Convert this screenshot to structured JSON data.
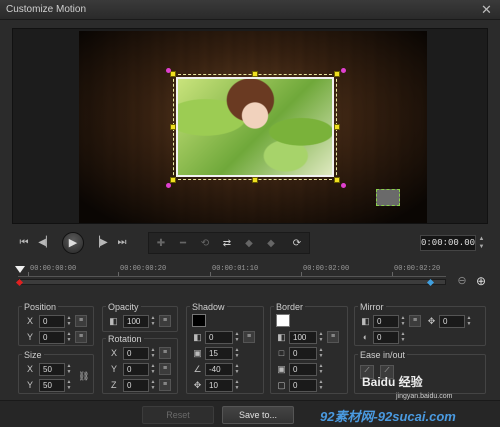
{
  "window": {
    "title": "Customize Motion",
    "close_glyph": "✕"
  },
  "player": {
    "timecode": "0:00:00.00",
    "buttons": [
      "go-to-start",
      "previous-frame",
      "play",
      "next-frame",
      "go-to-end"
    ]
  },
  "keyframe_tools": [
    "add-keyframe",
    "remove-keyframe",
    "reverse-keyframe",
    "swap-keyframes",
    "previous-keyframe",
    "next-keyframe",
    "duplicate-keyframe"
  ],
  "timeline": {
    "labels": [
      "00:00:00:00",
      "00:00:00:20",
      "00:00:01:10",
      "00:00:02:00",
      "00:00:02:20"
    ],
    "playhead_fraction": 0.0
  },
  "position": {
    "title": "Position",
    "x_label": "X",
    "x": "0",
    "y_label": "Y",
    "y": "0"
  },
  "size": {
    "title": "Size",
    "x_label": "X",
    "x": "50",
    "y_label": "Y",
    "y": "50"
  },
  "opacity": {
    "title": "Opacity",
    "value": "100"
  },
  "rotation": {
    "title": "Rotation",
    "x_label": "X",
    "x": "0",
    "y_label": "Y",
    "y": "0",
    "z_label": "Z",
    "z": "0"
  },
  "shadow": {
    "title": "Shadow",
    "color": "#000000",
    "opacity": "0",
    "blur": "15",
    "direction": "-40",
    "distance": "10"
  },
  "border": {
    "title": "Border",
    "color": "#ffffff",
    "opacity": "100",
    "width": "0",
    "blur": "0",
    "distance": "0"
  },
  "mirror": {
    "title": "Mirror",
    "opacity": "0",
    "distance": "0",
    "offset": "0"
  },
  "ease": {
    "title": "Ease in/out"
  },
  "buttons": {
    "reset": "Reset",
    "save": "Save to..."
  },
  "watermark": {
    "line1": "Baidu 经验",
    "line2": "jingyan.baidu.com",
    "line3": "92素材网-92sucai.com"
  }
}
